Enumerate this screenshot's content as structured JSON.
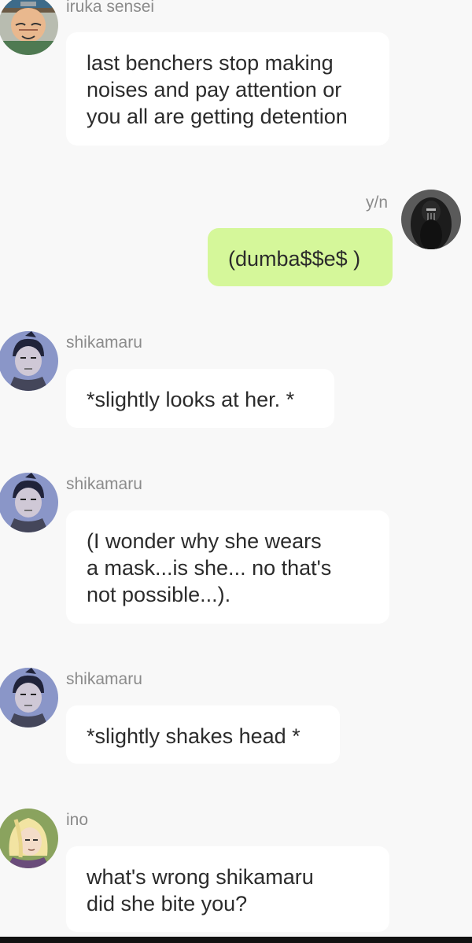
{
  "messages": [
    {
      "sender": "iruka sensei",
      "text": "last benchers stop making\nnoises and pay attention or\nyou all are getting detention",
      "avatar": "iruka-avatar"
    },
    {
      "sender": "y/n",
      "text": "(dumba$$e$ )",
      "avatar": "yn-avatar",
      "outgoing": true,
      "bubble_color": "#d5f79a"
    },
    {
      "sender": "shikamaru",
      "text": "*slightly looks at her. *",
      "avatar": "shikamaru-avatar"
    },
    {
      "sender": "shikamaru",
      "text": "(I wonder why she wears\na mask...is she...  no that's\nnot possible...).",
      "avatar": "shikamaru-avatar"
    },
    {
      "sender": "shikamaru",
      "text": "*slightly shakes head *",
      "avatar": "shikamaru-avatar"
    },
    {
      "sender": "ino",
      "text": "what's wrong shikamaru\ndid she bite you?",
      "avatar": "ino-avatar"
    }
  ]
}
